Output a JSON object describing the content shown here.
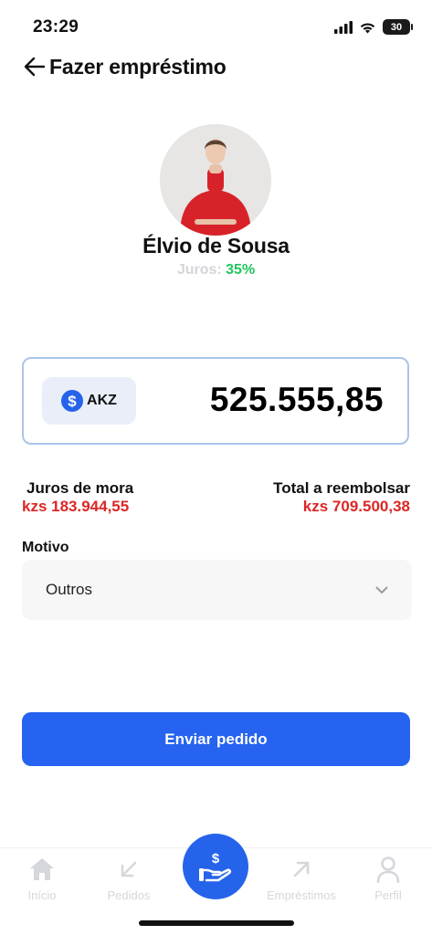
{
  "status_bar": {
    "time": "23:29",
    "battery": "30"
  },
  "header": {
    "title": "Fazer empréstimo"
  },
  "profile": {
    "name": "Élvio de Sousa",
    "rate_label": "Juros: ",
    "rate_value": "35%"
  },
  "amount": {
    "currency": "AKZ",
    "value": "525.555,85"
  },
  "fees": {
    "late_label": "Juros de mora",
    "late_value": "kzs 183.944,55",
    "total_label": "Total a reembolsar",
    "total_value": "kzs 709.500,38"
  },
  "reason": {
    "label": "Motivo",
    "value": "Outros"
  },
  "submit": {
    "label": "Enviar pedido"
  },
  "tabbar": {
    "items": [
      {
        "label": "Início",
        "icon": "home-icon"
      },
      {
        "label": "Pedidos",
        "icon": "arrow-down-left-icon"
      },
      {
        "label": "Empréstimos",
        "icon": "arrow-up-right-icon"
      },
      {
        "label": "Perfil",
        "icon": "user-icon"
      }
    ],
    "center_icon": "hand-money-icon"
  },
  "colors": {
    "accent": "#2563eb",
    "positive": "#22c55e",
    "negative": "#dc2626",
    "card_border": "#a9c5e8",
    "tab_inactive": "#d5d7dc"
  }
}
